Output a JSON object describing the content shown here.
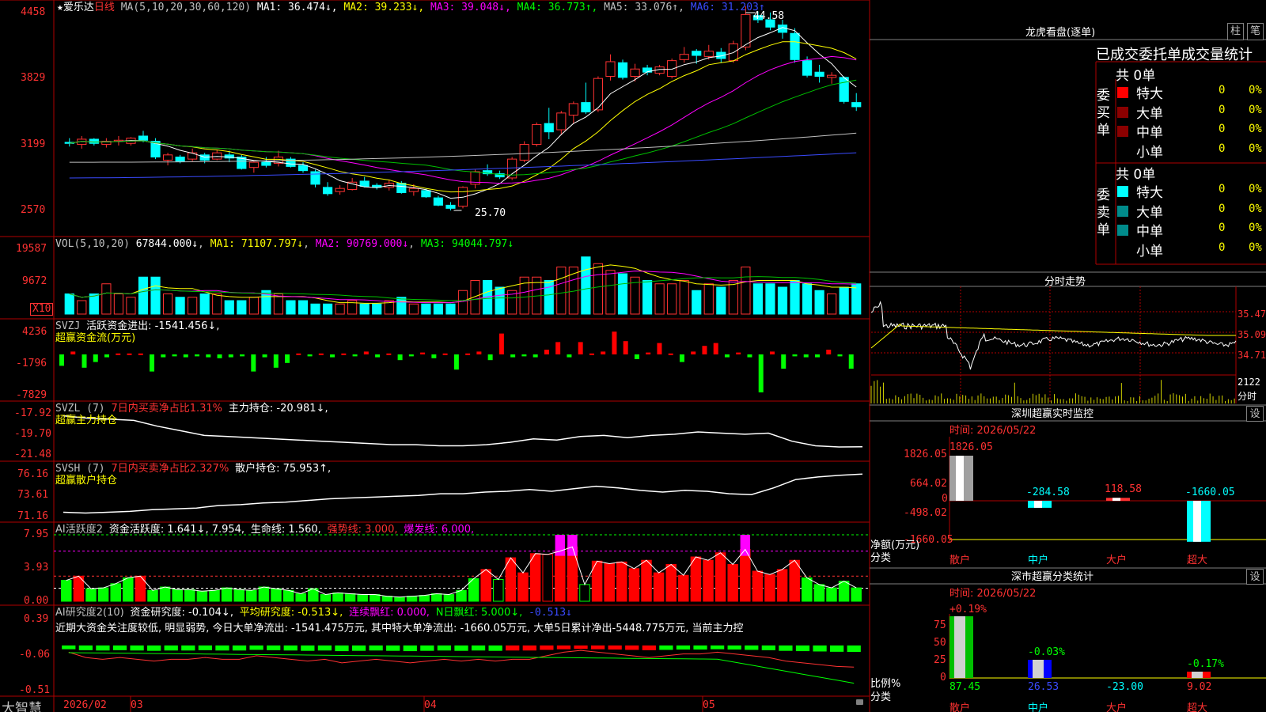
{
  "header": {
    "star": "★",
    "stock_name": "爱乐达",
    "period": "日线",
    "ma_title": "MA(5,10,20,30,60,120)",
    "ma": [
      {
        "label": "MA1: 36.474",
        "arrow": "↓",
        "color": "#ffffff"
      },
      {
        "label": "MA2: 39.233",
        "arrow": "↓",
        "color": "#ffff00"
      },
      {
        "label": "MA3: 39.048",
        "arrow": "↓",
        "color": "#ff00ff"
      },
      {
        "label": "MA4: 36.773",
        "arrow": "↑",
        "color": "#00ff00"
      },
      {
        "label": "MA5: 33.076",
        "arrow": "↑",
        "color": "#c0c0c0"
      },
      {
        "label": "MA6: 31.203",
        "arrow": "↑",
        "color": "#3a4bff"
      }
    ]
  },
  "price_axis": [
    "4458",
    "3829",
    "3199",
    "2570"
  ],
  "price_marks": {
    "high": "44.58",
    "low": "25.70"
  },
  "vol": {
    "title": "VOL(5,10,20)",
    "value": "67844.000",
    "ma1": "MA1: 71107.797",
    "ma2": "MA2: 90769.000",
    "ma3": "MA3: 94044.797",
    "arrow": "↓",
    "axis": [
      "19587",
      "9672"
    ],
    "unit": "X10"
  },
  "svzj": {
    "title": "SVZJ",
    "text": "活跃资金进出: -1541.456↓,",
    "subtitle": "超赢资金流(万元)",
    "axis": [
      "4236",
      "-1796",
      "-7829"
    ]
  },
  "svzl": {
    "title": "SVZL (7)",
    "red_text": "7日内买卖净占比1.31%",
    "text": "主力持仓: -20.981↓,",
    "subtitle": "超赢主力持仓",
    "axis": [
      "-17.92",
      "-19.70",
      "-21.48"
    ]
  },
  "svsh": {
    "title": "SVSH (7)",
    "red_text": "7日内买卖净占比2.327%",
    "text": "散户持仓: 75.953↑,",
    "subtitle": "超赢散户持仓",
    "axis": [
      "76.16",
      "73.61",
      "71.16"
    ]
  },
  "ai_active": {
    "title": "AI活跃度2",
    "text1": "资金活跃度: 1.641↓, 7.954,",
    "text2": "生命线: 1.560,",
    "strong": "强势线: 3.000,",
    "burst": "爆发线: 6.000,",
    "axis": [
      "7.95",
      "3.93",
      "0.00"
    ]
  },
  "ai_research": {
    "title": "AI研究度2(10)",
    "t1": "资金研究度: -0.104↓,",
    "t2": "平均研究度: -0.513↓,",
    "t3": "连续飘红: 0.000,",
    "t4": "N日飘红: 5.000↓,",
    "t5": "-0.513↓",
    "comment": "近期大资金关注度较低, 明显弱势, 今日大单净流出: -1541.475万元, 其中特大单净流出: -1660.05万元, 大单5日累计净出-5448.775万元, 当前主力控",
    "axis": [
      "0.39",
      "-0.06",
      "-0.51"
    ]
  },
  "xaxis": {
    "brand": "大智慧",
    "dates": [
      "2026/02",
      "03",
      "04",
      "05"
    ]
  },
  "right": {
    "lhb_title": "龙虎看盘(逐单)",
    "btn_zhu": "柱",
    "btn_bi": "笔",
    "stats_title": "已成交委托单成交量统计",
    "buy_side": "委买单",
    "sell_side": "委卖单",
    "buy_total": "共 0单",
    "sell_total": "共 0单",
    "rows": [
      "特大",
      "大单",
      "中单",
      "小单"
    ],
    "zero": "0",
    "pct": "0%",
    "buy_colors": [
      "#ff0000",
      "#8b0000",
      "#8b0000",
      "#000000"
    ],
    "sell_colors": [
      "#00ffff",
      "#008b8b",
      "#008b8b",
      "#000000"
    ],
    "minute_title": "分时走势",
    "minute_axis": [
      "35.47",
      "35.09",
      "34.71",
      "2122",
      "分时"
    ],
    "sz_title": "深圳超赢实时监控",
    "sz_btn": "设",
    "sz_time": "时间: 2026/05/22",
    "sz_axis": [
      "1826.05",
      "664.02",
      "0",
      "-498.02",
      "-1660.05"
    ],
    "sz_unit": "净额(万元)",
    "sz_class": "分类",
    "sz_values": [
      "1826.05",
      "-284.58",
      "118.58",
      "-1660.05"
    ],
    "categories": [
      "散户",
      "中户",
      "大户",
      "超大"
    ],
    "cls_title": "深市超赢分类统计",
    "cls_btn": "设",
    "cls_time": "时间: 2026/05/22",
    "cls_axis": [
      "75",
      "50",
      "25",
      "0"
    ],
    "cls_changes": [
      "+0.19%",
      "-0.03%",
      "",
      "-0.17%"
    ],
    "cls_values": [
      "87.45",
      "26.53",
      "-23.00",
      "9.02"
    ],
    "cls_unit": "比例%",
    "cls_class": "分类"
  },
  "chart_data": {
    "type": "candlestick",
    "title": "爱乐达 日线",
    "high_mark": 44.58,
    "low_mark": 25.7,
    "ma_last": {
      "MA1": 36.474,
      "MA2": 39.233,
      "MA3": 39.048,
      "MA4": 36.773,
      "MA5": 33.076,
      "MA6": 31.203
    },
    "ohlc": [
      [
        32.2,
        32.6,
        31.8,
        32.1
      ],
      [
        32.0,
        32.8,
        31.6,
        32.5
      ],
      [
        32.5,
        32.6,
        31.9,
        32.1
      ],
      [
        32.0,
        32.6,
        31.7,
        32.3
      ],
      [
        32.3,
        32.8,
        31.9,
        32.4
      ],
      [
        32.1,
        32.7,
        31.9,
        32.6
      ],
      [
        32.8,
        33.3,
        32.2,
        32.4
      ],
      [
        32.3,
        32.6,
        30.6,
        30.8
      ],
      [
        30.5,
        31.2,
        30.0,
        31.0
      ],
      [
        30.8,
        31.0,
        30.2,
        30.4
      ],
      [
        30.6,
        31.6,
        30.4,
        31.2
      ],
      [
        31.0,
        31.2,
        30.2,
        30.5
      ],
      [
        30.6,
        31.5,
        30.5,
        31.2
      ],
      [
        31.0,
        31.4,
        30.3,
        30.7
      ],
      [
        30.8,
        31.0,
        29.6,
        29.7
      ],
      [
        29.8,
        30.4,
        29.3,
        30.3
      ],
      [
        30.3,
        30.8,
        29.8,
        30.0
      ],
      [
        30.2,
        31.4,
        29.9,
        30.8
      ],
      [
        30.6,
        30.8,
        29.8,
        29.9
      ],
      [
        30.0,
        30.3,
        29.3,
        29.5
      ],
      [
        29.4,
        29.6,
        27.9,
        28.2
      ],
      [
        27.9,
        28.4,
        27.1,
        27.3
      ],
      [
        27.5,
        28.1,
        27.2,
        27.8
      ],
      [
        27.7,
        28.8,
        27.6,
        28.4
      ],
      [
        28.5,
        28.9,
        27.9,
        28.0
      ],
      [
        28.1,
        28.3,
        27.7,
        27.9
      ],
      [
        27.9,
        28.6,
        27.6,
        28.3
      ],
      [
        28.3,
        28.5,
        27.3,
        27.4
      ],
      [
        27.5,
        28.2,
        27.1,
        27.8
      ],
      [
        27.6,
        27.8,
        26.9,
        27.0
      ],
      [
        26.9,
        27.1,
        26.1,
        26.2
      ],
      [
        26.2,
        26.5,
        25.7,
        25.9
      ],
      [
        26.1,
        28.0,
        25.9,
        27.9
      ],
      [
        28.2,
        29.6,
        27.8,
        29.4
      ],
      [
        29.5,
        30.1,
        29.0,
        29.2
      ],
      [
        29.2,
        29.5,
        28.7,
        28.9
      ],
      [
        28.8,
        30.8,
        28.6,
        30.6
      ],
      [
        30.5,
        32.3,
        30.3,
        32.0
      ],
      [
        32.0,
        34.1,
        31.8,
        33.9
      ],
      [
        34.0,
        35.5,
        32.5,
        33.2
      ],
      [
        33.4,
        35.2,
        32.9,
        35.0
      ],
      [
        34.8,
        36.1,
        34.0,
        35.9
      ],
      [
        36.0,
        37.9,
        34.9,
        35.1
      ],
      [
        35.3,
        38.5,
        35.1,
        38.3
      ],
      [
        38.5,
        40.6,
        38.1,
        39.9
      ],
      [
        39.8,
        40.1,
        38.2,
        38.4
      ],
      [
        38.5,
        39.7,
        38.0,
        39.2
      ],
      [
        39.3,
        39.6,
        38.6,
        38.9
      ],
      [
        38.8,
        39.6,
        38.6,
        39.4
      ],
      [
        38.5,
        40.2,
        38.3,
        40.0
      ],
      [
        40.1,
        41.3,
        39.8,
        40.6
      ],
      [
        40.9,
        41.1,
        39.7,
        40.5
      ],
      [
        40.4,
        41.5,
        40.1,
        40.9
      ],
      [
        40.8,
        41.2,
        39.8,
        40.2
      ],
      [
        40.0,
        41.9,
        39.8,
        41.6
      ],
      [
        41.3,
        45.2,
        41.0,
        44.4
      ],
      [
        44.3,
        44.7,
        43.6,
        43.9
      ],
      [
        43.9,
        44.6,
        42.9,
        43.2
      ],
      [
        43.4,
        43.9,
        42.1,
        42.7
      ],
      [
        42.6,
        43.1,
        39.8,
        40.1
      ],
      [
        40.0,
        40.4,
        38.4,
        38.6
      ],
      [
        38.9,
        39.6,
        37.9,
        38.5
      ],
      [
        38.4,
        38.9,
        37.8,
        38.6
      ],
      [
        38.4,
        38.5,
        35.9,
        36.1
      ],
      [
        36.0,
        36.9,
        35.2,
        35.6
      ]
    ],
    "volume": [
      6,
      4,
      6,
      9,
      6,
      5,
      11,
      11,
      6,
      5,
      5,
      6,
      6,
      4,
      4,
      5,
      7,
      6,
      4,
      4,
      3,
      3,
      3,
      4,
      3,
      3,
      4,
      5,
      3,
      3,
      3,
      3,
      7,
      10,
      10,
      8,
      7,
      11,
      11,
      10,
      14,
      14,
      17,
      15,
      13,
      12,
      11,
      10,
      9,
      9,
      10,
      7,
      9,
      8,
      10,
      14,
      9,
      9,
      8,
      10,
      9,
      7,
      6,
      8,
      9
    ],
    "fund_flow": [
      -1.2,
      0.3,
      -1.4,
      -0.8,
      -0.3,
      0.1,
      0.1,
      0.1,
      -1.8,
      -0.3,
      -0.2,
      -0.3,
      -0.2,
      -0.3,
      -0.4,
      -0.3,
      -0.2,
      -1.8,
      -0.3,
      -1.4,
      -0.9,
      0.1,
      -0.2,
      0.1,
      -0.3,
      0.1,
      -0.2,
      0.3,
      -0.3,
      0.1,
      -0.6,
      -0.2,
      0.2,
      -0.4,
      0.1,
      -1.6,
      0.1,
      0.3,
      -0.6,
      2.2,
      -0.3,
      -0.2,
      -0.3,
      0.5,
      1.3,
      -0.3,
      1.3,
      0.1,
      0.3,
      2.4,
      1.4,
      -0.5,
      0.2,
      1.2,
      0.1,
      -0.8,
      0.3,
      0.9,
      1.2,
      -0.3,
      0.2,
      -0.3,
      -4.0,
      0.3,
      -1.5,
      -0.2,
      -0.3,
      -0.3,
      0.5,
      -0.2,
      -1.5
    ],
    "main_position": [
      -18.3,
      -18.5,
      -18.6,
      -18.7,
      -19.2,
      -19.6,
      -20.0,
      -20.1,
      -20.2,
      -20.3,
      -20.4,
      -20.5,
      -20.6,
      -20.7,
      -20.8,
      -20.8,
      -20.9,
      -20.9,
      -20.8,
      -20.6,
      -20.3,
      -20.4,
      -20.1,
      -20.0,
      -20.2,
      -20.0,
      -19.9,
      -19.7,
      -19.8,
      -19.9,
      -19.8,
      -20.5,
      -20.9,
      -21.0,
      -20.98
    ],
    "retail_position": [
      71.4,
      71.3,
      71.4,
      71.5,
      71.7,
      71.8,
      71.9,
      72.2,
      72.3,
      72.5,
      72.6,
      72.8,
      73.0,
      73.1,
      73.2,
      73.3,
      73.4,
      73.6,
      73.6,
      73.8,
      73.9,
      74.1,
      73.9,
      74.2,
      74.5,
      74.3,
      74.0,
      73.8,
      74.0,
      73.9,
      73.6,
      73.5,
      74.3,
      75.3,
      75.6,
      75.8,
      75.953
    ],
    "activity": [
      2.5,
      3.0,
      1.5,
      1.6,
      2.1,
      2.8,
      3.0,
      1.3,
      1.7,
      1.4,
      1.4,
      1.2,
      1.3,
      1.6,
      1.4,
      1.3,
      1.7,
      1.5,
      1.3,
      0.9,
      1.5,
      0.8,
      1.0,
      0.9,
      0.8,
      0.8,
      0.6,
      0.5,
      0.6,
      0.7,
      0.9,
      0.8,
      1.3,
      2.7,
      3.8,
      2.6,
      5.2,
      3.4,
      5.7,
      5.6,
      6.0,
      6.5,
      2.0,
      4.8,
      4.5,
      4.7,
      3.9,
      4.9,
      3.4,
      4.4,
      3.1,
      5.3,
      4.9,
      5.8,
      4.4,
      6.2,
      3.6,
      3.2,
      3.8,
      4.9,
      2.8,
      2.0,
      1.6,
      2.4,
      1.6
    ],
    "research": [
      -0.02,
      -0.05,
      -0.06,
      -0.05,
      -0.06,
      -0.07,
      -0.06,
      -0.06,
      -0.05,
      -0.06,
      -0.06,
      -0.04,
      -0.05,
      -0.06,
      -0.07,
      -0.06,
      -0.08,
      -0.07,
      -0.06,
      -0.07,
      -0.08,
      -0.07,
      -0.06,
      -0.07,
      -0.06,
      -0.07,
      -0.06,
      -0.06,
      -0.04,
      -0.02,
      -0.01,
      -0.02,
      -0.03,
      -0.04,
      -0.05,
      -0.04,
      -0.03,
      -0.03,
      -0.02,
      -0.03,
      -0.04,
      -0.05,
      -0.07,
      -0.08,
      -0.09,
      -0.1,
      -0.104
    ]
  }
}
